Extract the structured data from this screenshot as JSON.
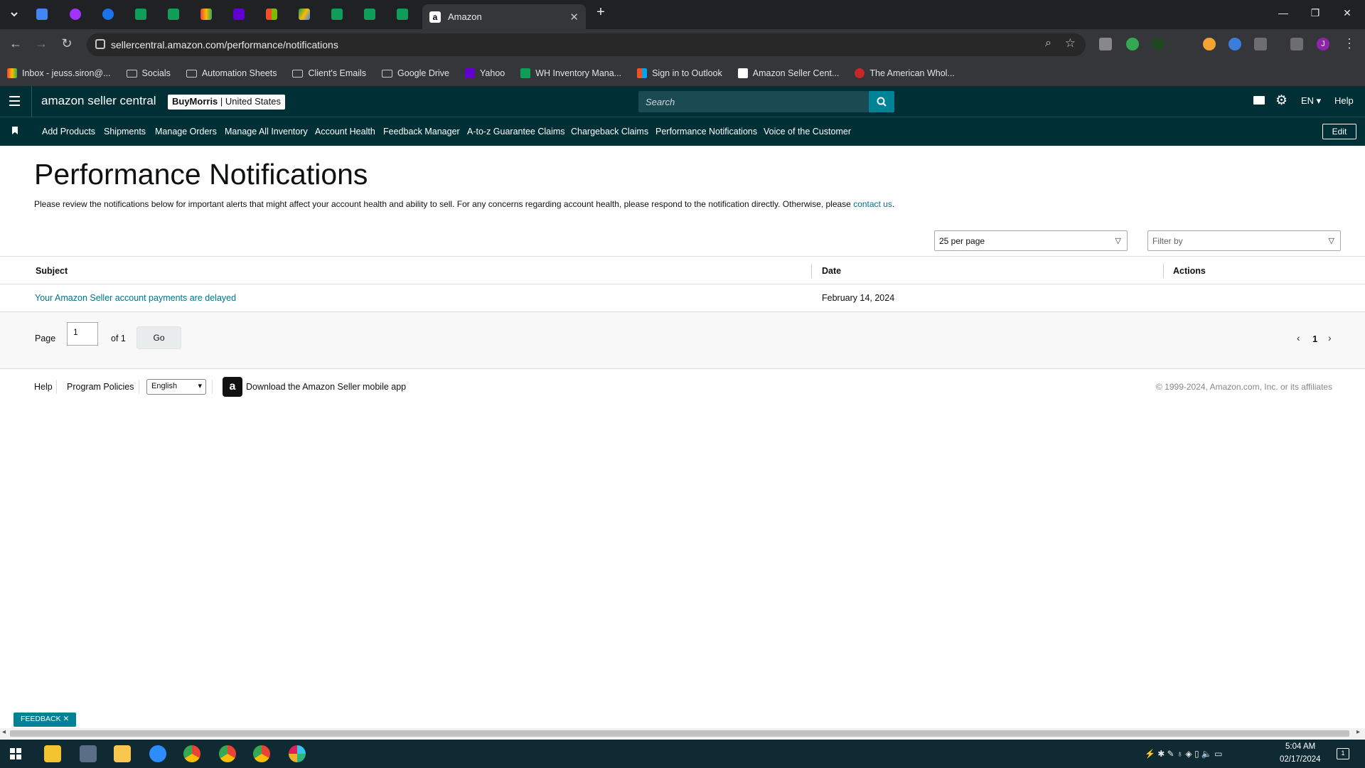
{
  "browser": {
    "active_tab_title": "Amazon",
    "url": "sellercentral.amazon.com/performance/notifications",
    "profile_initial": "J",
    "colors": {
      "tabstrip": "#202124",
      "toolbar": "#35363a"
    },
    "tab_favicons": [
      "docs-icon",
      "messenger-icon",
      "onepassword-icon",
      "sheets-icon",
      "sheets-icon",
      "gmail-icon",
      "yahoo-icon",
      "microsoft-icon",
      "drive-icon",
      "sheets-icon",
      "sheets-icon",
      "sheets-icon"
    ]
  },
  "bookmarks": [
    {
      "label": "Inbox - jeuss.siron@...",
      "icon": "gmail-icon"
    },
    {
      "label": "Socials",
      "icon": "folder-icon"
    },
    {
      "label": "Automation Sheets",
      "icon": "folder-icon"
    },
    {
      "label": "Client's Emails",
      "icon": "folder-icon"
    },
    {
      "label": "Google Drive",
      "icon": "folder-icon"
    },
    {
      "label": "Yahoo",
      "icon": "yahoo-icon"
    },
    {
      "label": "WH Inventory Mana...",
      "icon": "sheets-icon"
    },
    {
      "label": "Sign in to Outlook",
      "icon": "microsoft-icon"
    },
    {
      "label": "Amazon Seller Cent...",
      "icon": "amazon-icon"
    },
    {
      "label": "The American Whol...",
      "icon": "globe-icon"
    }
  ],
  "header": {
    "logo": "amazon seller central",
    "store_name": "BuyMorris",
    "store_region": "United States",
    "search_placeholder": "Search",
    "language": "EN",
    "help": "Help",
    "colors": {
      "bg": "#002f36",
      "accent": "#008296"
    }
  },
  "nav": {
    "items": [
      "Add Products",
      "Shipments",
      "Manage Orders",
      "Manage All Inventory",
      "Account Health",
      "Feedback Manager",
      "A-to-z Guarantee Claims",
      "Chargeback Claims",
      "Performance Notifications",
      "Voice of the Customer"
    ],
    "edit": "Edit"
  },
  "page": {
    "title": "Performance Notifications",
    "description": "Please review the notifications below for important alerts that might affect your account health and ability to sell. For any concerns regarding account health, please respond to the notification directly. Otherwise, please",
    "contact_link": "contact us",
    "per_page": "25 per page",
    "filter_placeholder": "Filter by"
  },
  "table": {
    "columns": [
      "Subject",
      "Date",
      "Actions"
    ],
    "rows": [
      {
        "subject": "Your Amazon Seller account payments are delayed",
        "date": "February 14, 2024",
        "actions": ""
      }
    ]
  },
  "pagination": {
    "page_label": "Page",
    "current": "1",
    "of_label": "of 1",
    "go": "Go",
    "page_number": "1"
  },
  "footer": {
    "help": "Help",
    "program_policies": "Program Policies",
    "language": "English",
    "app_text": "Download the Amazon Seller mobile app",
    "copyright": "© 1999-2024, Amazon.com, Inc. or its affiliates"
  },
  "feedback": "FEEDBACK",
  "taskbar": {
    "time": "5:04 AM",
    "date": "02/17/2024",
    "notification_count": "1"
  }
}
